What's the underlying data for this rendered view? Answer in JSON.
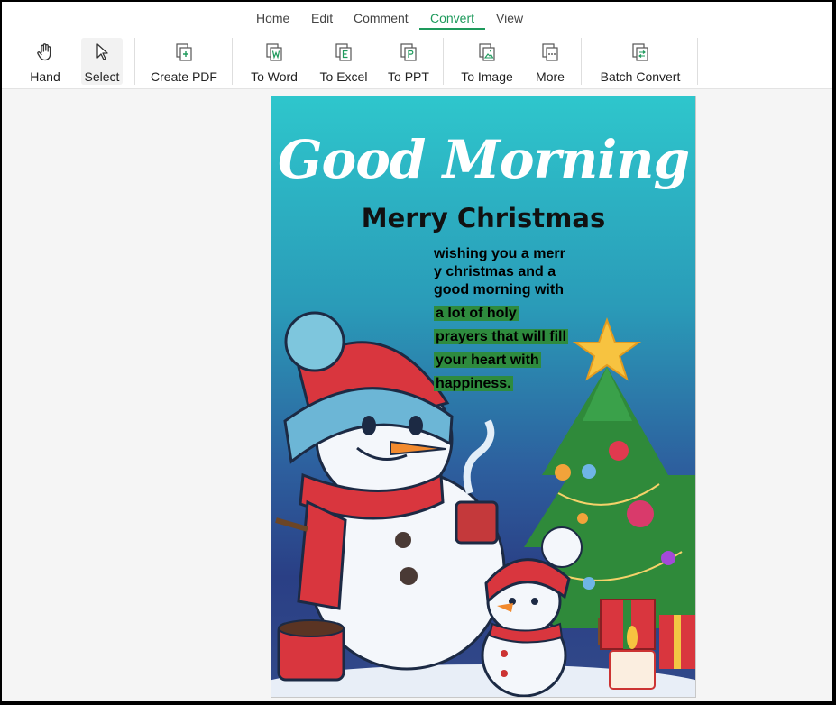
{
  "menu": {
    "tabs": [
      {
        "label": "Home"
      },
      {
        "label": "Edit"
      },
      {
        "label": "Comment"
      },
      {
        "label": "Convert",
        "active": true
      },
      {
        "label": "View"
      }
    ]
  },
  "toolbar": {
    "hand": "Hand",
    "select": "Select",
    "create_pdf": "Create PDF",
    "to_word": "To Word",
    "to_excel": "To Excel",
    "to_ppt": "To PPT",
    "to_image": "To Image",
    "more": "More",
    "batch_convert": "Batch Convert"
  },
  "document": {
    "title": "Good Morning",
    "subtitle": "Merry Christmas",
    "message_lines": [
      "wishing you a merr",
      "y christmas and a",
      "good morning with",
      "a lot of holy",
      "prayers that will fill",
      "your heart with",
      "happiness."
    ]
  },
  "colors": {
    "accent": "#1e9a5c",
    "highlight": "#2e8b3e"
  }
}
